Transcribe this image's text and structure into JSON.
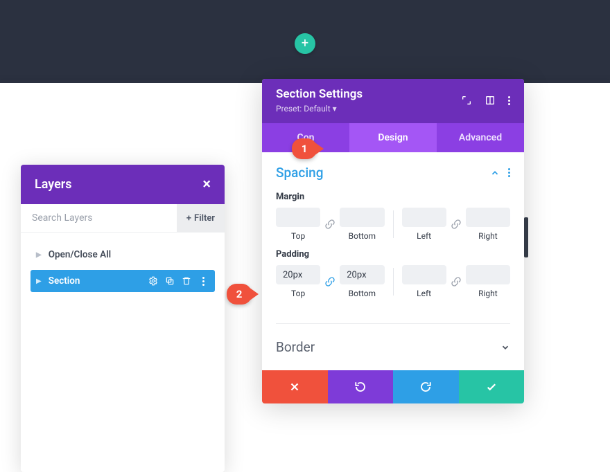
{
  "colors": {
    "purple_dark": "#6c2eb9",
    "purple_mid": "#8b3fe3",
    "purple_active": "#a456f5",
    "blue": "#2e9fe6",
    "teal": "#27c4a5",
    "red": "#f0513c"
  },
  "add_button": {
    "symbol": "+"
  },
  "layers_panel": {
    "title": "Layers",
    "close_symbol": "×",
    "search_placeholder": "Search Layers",
    "filter_label": "Filter",
    "filter_prefix": "+",
    "open_close_label": "Open/Close All",
    "items": [
      {
        "label": "Section",
        "selected": true
      }
    ]
  },
  "settings_panel": {
    "title": "Section Settings",
    "preset_label": "Preset: Default",
    "preset_caret": "▾",
    "tabs": [
      {
        "id": "content",
        "label": "Content",
        "truncated_prefix": "Con",
        "active": false
      },
      {
        "id": "design",
        "label": "Design",
        "active": true
      },
      {
        "id": "advanced",
        "label": "Advanced",
        "active": false
      }
    ],
    "sections": {
      "spacing": {
        "title": "Spacing",
        "expanded": true,
        "groups": [
          {
            "label": "Margin",
            "fields": {
              "top": {
                "value": "",
                "label": "Top"
              },
              "bottom": {
                "value": "",
                "label": "Bottom"
              },
              "left": {
                "value": "",
                "label": "Left"
              },
              "right": {
                "value": "",
                "label": "Right"
              }
            },
            "linked_tb": false,
            "linked_lr": false
          },
          {
            "label": "Padding",
            "fields": {
              "top": {
                "value": "20px",
                "label": "Top"
              },
              "bottom": {
                "value": "20px",
                "label": "Bottom"
              },
              "left": {
                "value": "",
                "label": "Left"
              },
              "right": {
                "value": "",
                "label": "Right"
              }
            },
            "linked_tb": true,
            "linked_lr": false
          }
        ]
      },
      "border": {
        "title": "Border",
        "expanded": false
      }
    }
  },
  "annotations": {
    "badge1": "1",
    "badge2": "2"
  }
}
